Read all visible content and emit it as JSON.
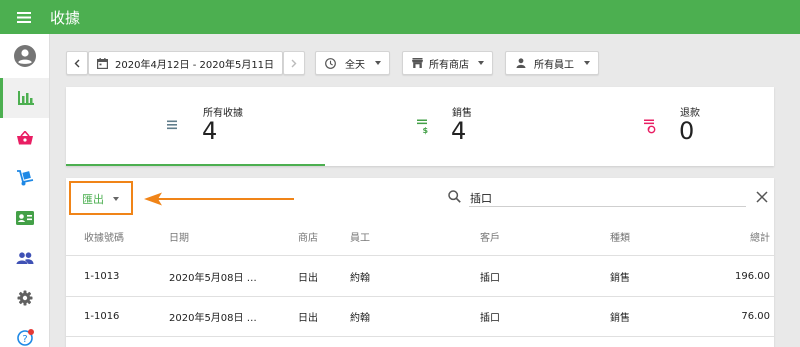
{
  "header": {
    "title": "收據"
  },
  "sidebar": {
    "items": [
      {
        "icon": "account-circle-icon",
        "active": false
      },
      {
        "icon": "bar-chart-icon",
        "active": true
      },
      {
        "icon": "basket-icon",
        "active": false
      },
      {
        "icon": "hand-truck-icon",
        "active": false
      },
      {
        "icon": "contact-card-icon",
        "active": false
      },
      {
        "icon": "people-icon",
        "active": false
      },
      {
        "icon": "gear-icon",
        "active": false
      },
      {
        "icon": "help-icon",
        "active": false,
        "badge": true
      }
    ]
  },
  "filters": {
    "date_range": "2020年4月12日 - 2020年5月11日",
    "time": "全天",
    "store": "所有商店",
    "employee": "所有員工"
  },
  "summary": [
    {
      "label": "所有收據",
      "value": "4",
      "color": "#607d8b",
      "icon": "receipt-icon"
    },
    {
      "label": "銷售",
      "value": "4",
      "color": "#43a047",
      "icon": "receipt-dollar-icon"
    },
    {
      "label": "退款",
      "value": "0",
      "color": "#e91e63",
      "icon": "receipt-refund-icon"
    }
  ],
  "toolbar": {
    "export_label": "匯出",
    "search_value": "插口"
  },
  "table": {
    "columns": [
      "收據號碼",
      "日期",
      "商店",
      "員工",
      "客戶",
      "種類",
      "總計"
    ],
    "rows": [
      [
        "1-1013",
        "2020年5月08日 …",
        "日出",
        "約翰",
        "插口",
        "銷售",
        "196.00"
      ],
      [
        "1-1016",
        "2020年5月08日 …",
        "日出",
        "約翰",
        "插口",
        "銷售",
        "76.00"
      ]
    ]
  },
  "colors": {
    "accent": "#4caf50",
    "highlight": "#f08418"
  }
}
